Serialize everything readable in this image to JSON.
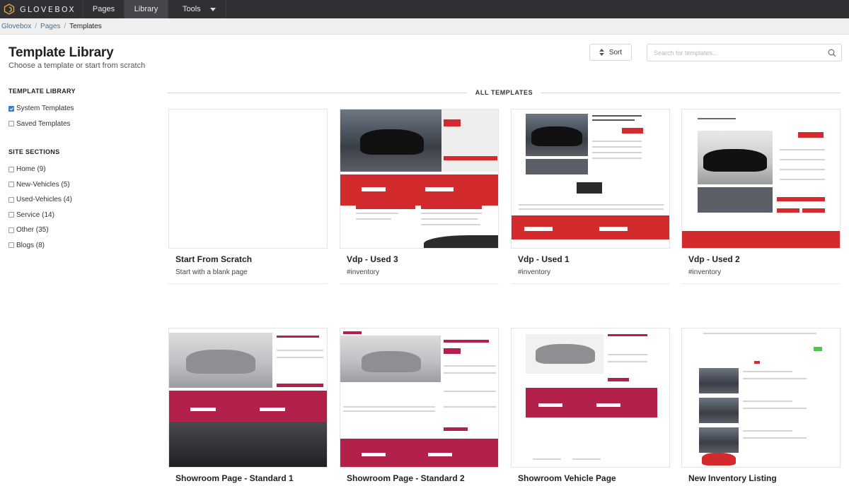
{
  "app": {
    "logo_text": "GLOVEBOX",
    "nav": [
      {
        "label": "Pages"
      },
      {
        "label": "Library"
      },
      {
        "label": "Tools"
      }
    ]
  },
  "breadcrumb": [
    {
      "label": "Glovebox"
    },
    {
      "label": "Pages"
    },
    {
      "label": "Templates"
    }
  ],
  "header": {
    "title": "Template Library",
    "subtitle": "Choose a template or start from scratch",
    "sort_label": "Sort",
    "search_placeholder": "Search for templates..."
  },
  "sidebar": {
    "library_heading": "TEMPLATE LIBRARY",
    "library_items": [
      {
        "label": "System Templates",
        "checked": true
      },
      {
        "label": "Saved Templates",
        "checked": false
      }
    ],
    "sections_heading": "SITE SECTIONS",
    "section_items": [
      {
        "label": "Home (9)",
        "checked": false
      },
      {
        "label": "New-Vehicles (5)",
        "checked": false
      },
      {
        "label": "Used-Vehicles (4)",
        "checked": false
      },
      {
        "label": "Service (14)",
        "checked": false
      },
      {
        "label": "Other (35)",
        "checked": false
      },
      {
        "label": "Blogs (8)",
        "checked": false
      }
    ]
  },
  "main": {
    "section_label": "ALL TEMPLATES",
    "templates": [
      {
        "title": "Start From Scratch",
        "tag": "Start with a blank page"
      },
      {
        "title": "Vdp - Used 3",
        "tag": "#inventory"
      },
      {
        "title": "Vdp - Used 1",
        "tag": "#inventory"
      },
      {
        "title": "Vdp - Used 2",
        "tag": "#inventory"
      },
      {
        "title": "Showroom Page - Standard 1",
        "tag": ""
      },
      {
        "title": "Showroom Page - Standard 2",
        "tag": ""
      },
      {
        "title": "Showroom Vehicle Page",
        "tag": ""
      },
      {
        "title": "New Inventory Listing",
        "tag": ""
      }
    ]
  },
  "colors": {
    "nav_bg": "#2f2f34",
    "accent_red": "#d32a2d",
    "accent_crimson": "#b3214a",
    "checkbox_blue": "#2e7bd9"
  }
}
